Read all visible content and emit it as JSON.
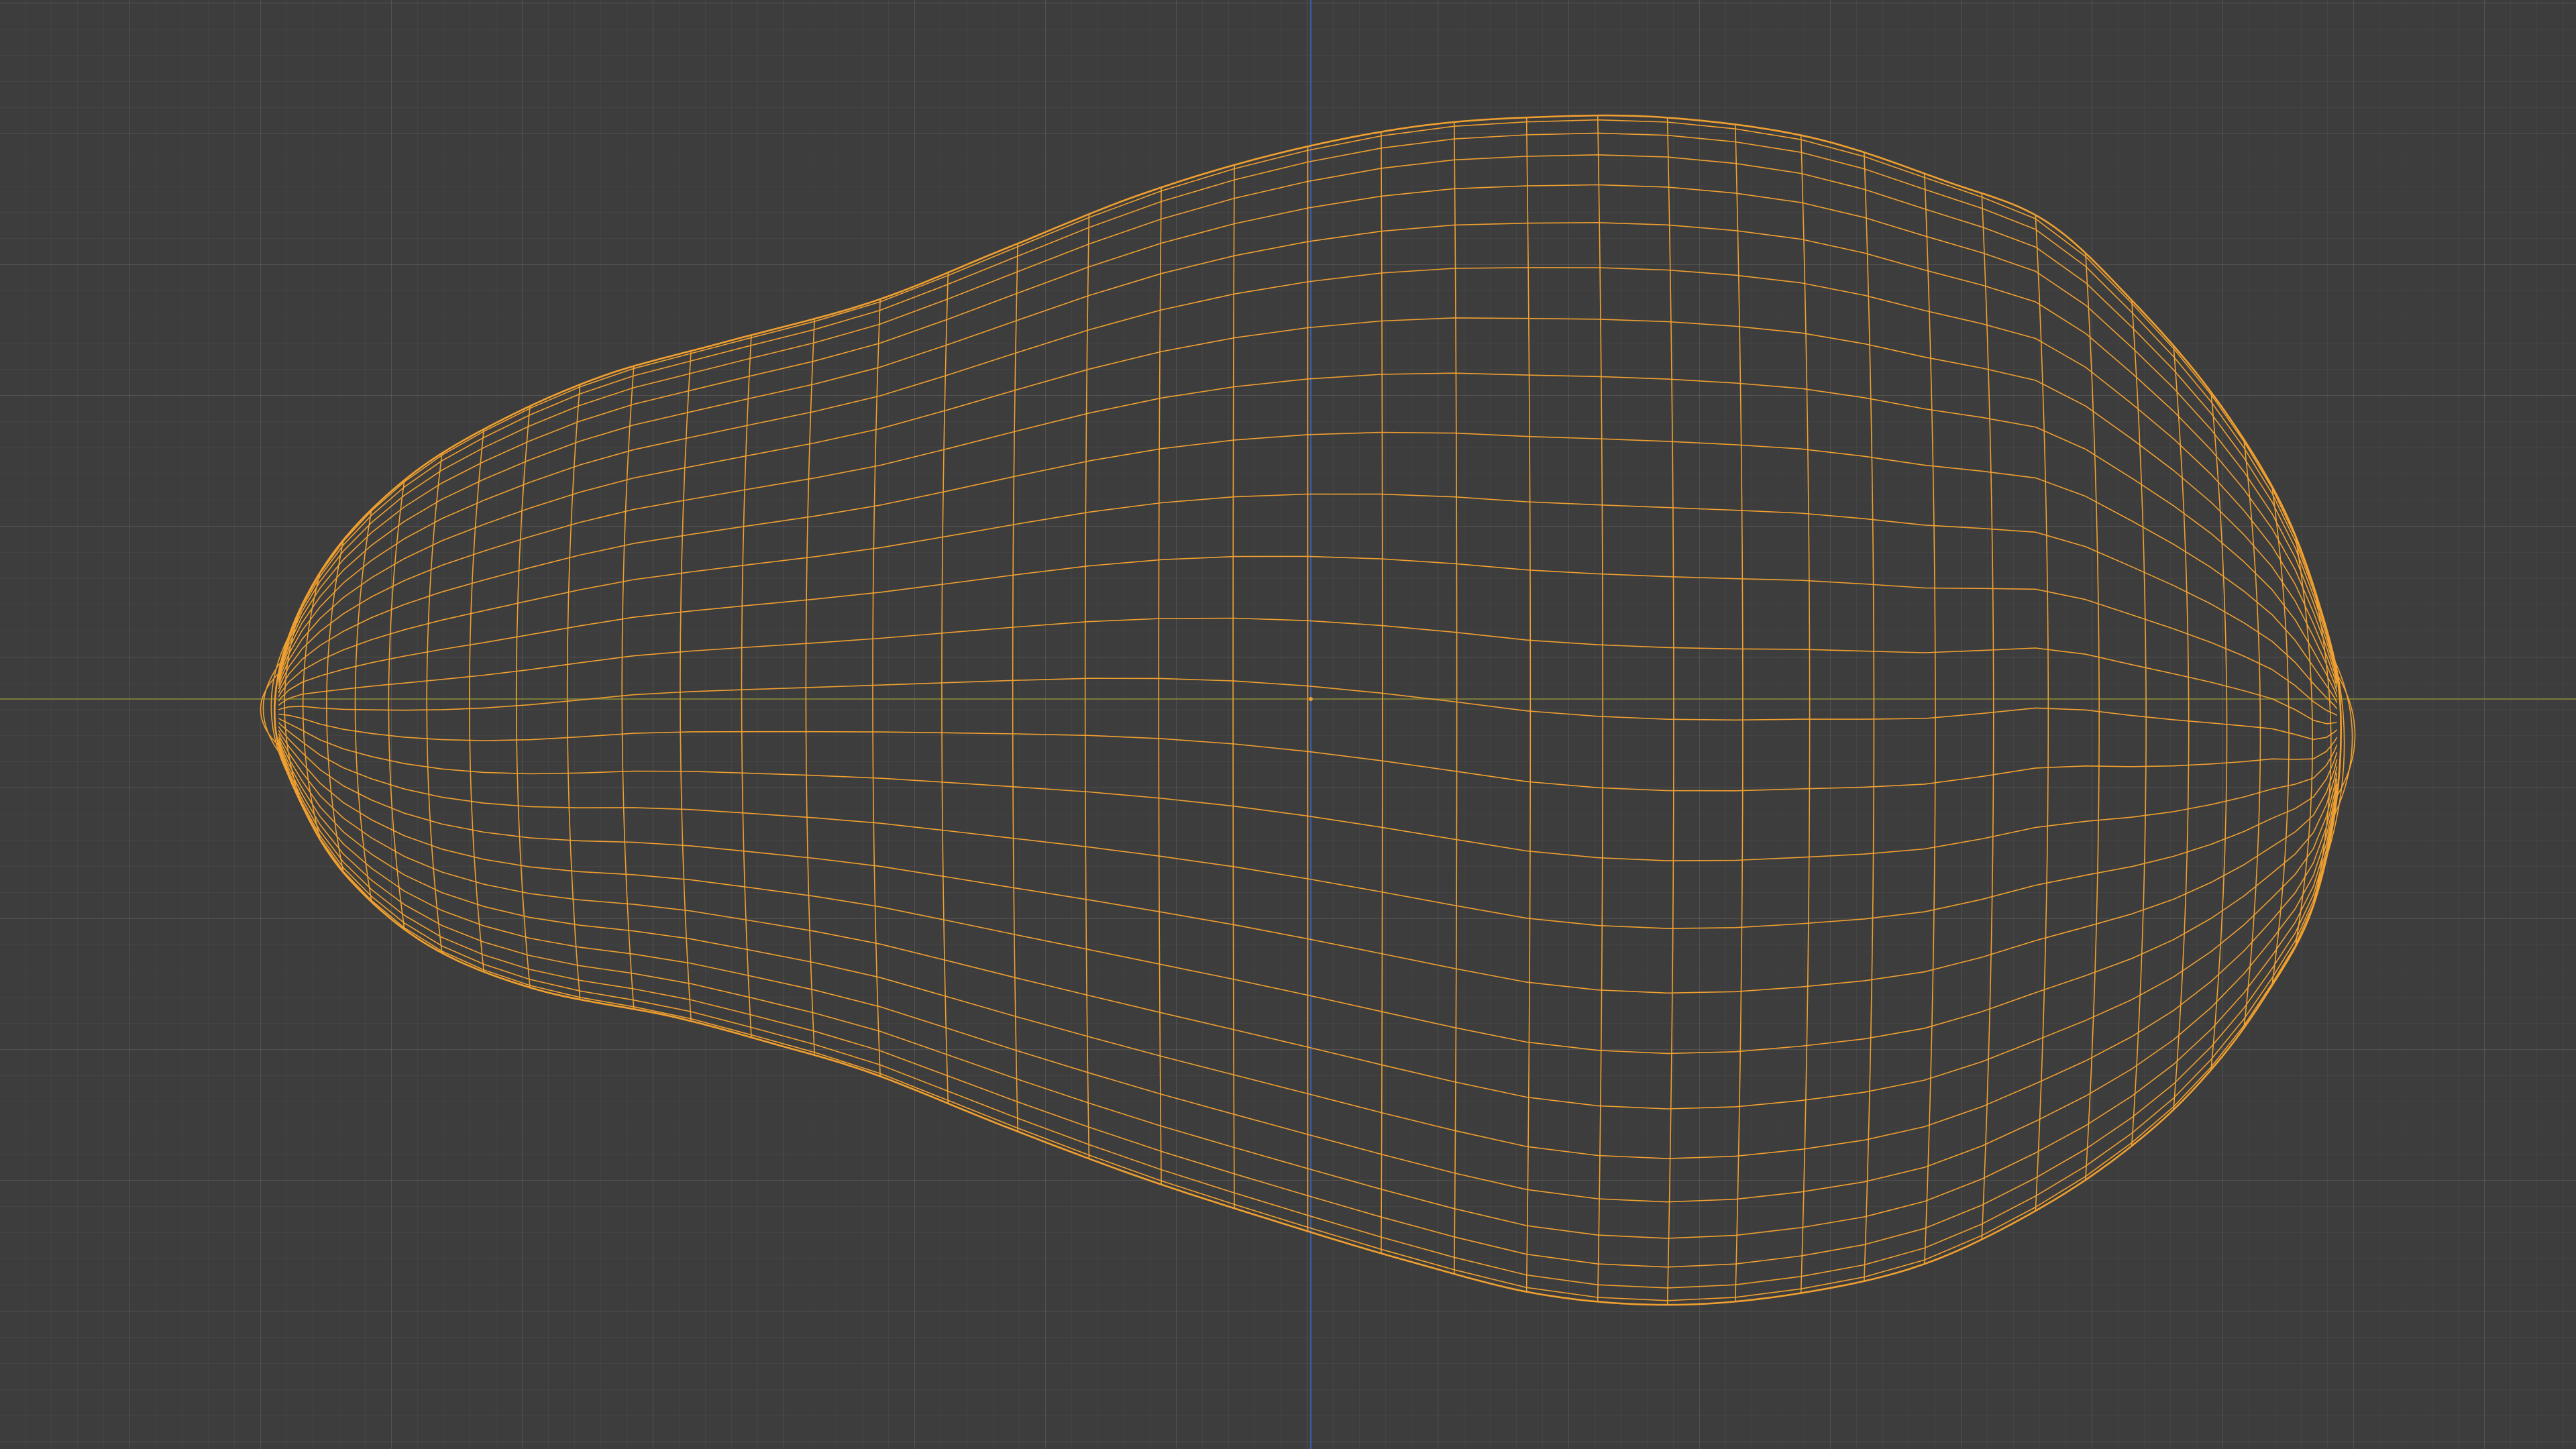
{
  "viewport": {
    "background_color": "#3d3d3d",
    "grid_color": "#4a4a4a",
    "x_axis_color": "#7a7a3a",
    "y_axis_color": "#3a5ea8",
    "wireframe_color": "#f0a030",
    "origin_color": "#f0a030",
    "object": "wireframe-mesh-selected"
  }
}
